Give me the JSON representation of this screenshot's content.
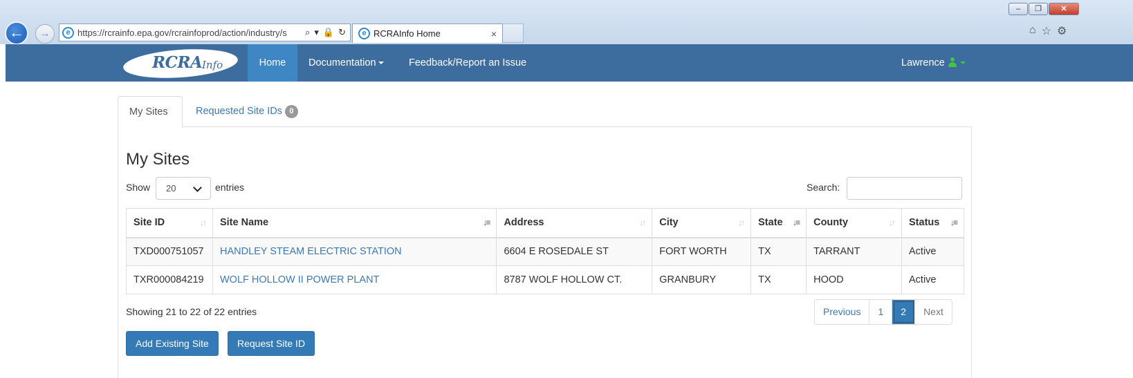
{
  "browser": {
    "url": "https://rcrainfo.epa.gov/rcrainfoprod/action/industry/s",
    "tab_title": "RCRAInfo Home",
    "tab_close": "×",
    "tools": {
      "search": "⌕",
      "dropdown": "▾",
      "lock": "🔒",
      "refresh": "↻"
    },
    "icons": {
      "home": "⌂",
      "favorites": "☆",
      "settings": "⚙"
    }
  },
  "navbar": {
    "logo_text": "RCRA",
    "logo_sub": "Info",
    "home": "Home",
    "documentation": "Documentation",
    "feedback": "Feedback/Report an Issue",
    "user": "Lawrence",
    "color": "#3d6d9e",
    "active_color": "#3e86c4"
  },
  "tabs": {
    "my_sites": "My Sites",
    "requested": "Requested Site IDs",
    "requested_count": "0"
  },
  "main": {
    "title": "My Sites",
    "show_label": "Show",
    "page_length": "20",
    "entries_label": "entries",
    "search_label": "Search:",
    "search_value": ""
  },
  "table": {
    "headers": [
      "Site ID",
      "Site Name",
      "Address",
      "City",
      "State",
      "County",
      "Status"
    ],
    "rows": [
      [
        "TXD000751057",
        "HANDLEY STEAM ELECTRIC STATION",
        "6604 E ROSEDALE ST",
        "FORT WORTH",
        "TX",
        "TARRANT",
        "Active"
      ],
      [
        "TXR000084219",
        "WOLF HOLLOW II POWER PLANT",
        "8787 WOLF HOLLOW CT.",
        "GRANBURY",
        "TX",
        "HOOD",
        "Active"
      ]
    ]
  },
  "footer": {
    "info": "Showing 21 to 22 of 22 entries",
    "previous": "Previous",
    "page1": "1",
    "page2": "2",
    "next": "Next"
  },
  "buttons": {
    "add_existing": "Add Existing Site",
    "request_site": "Request Site ID"
  }
}
